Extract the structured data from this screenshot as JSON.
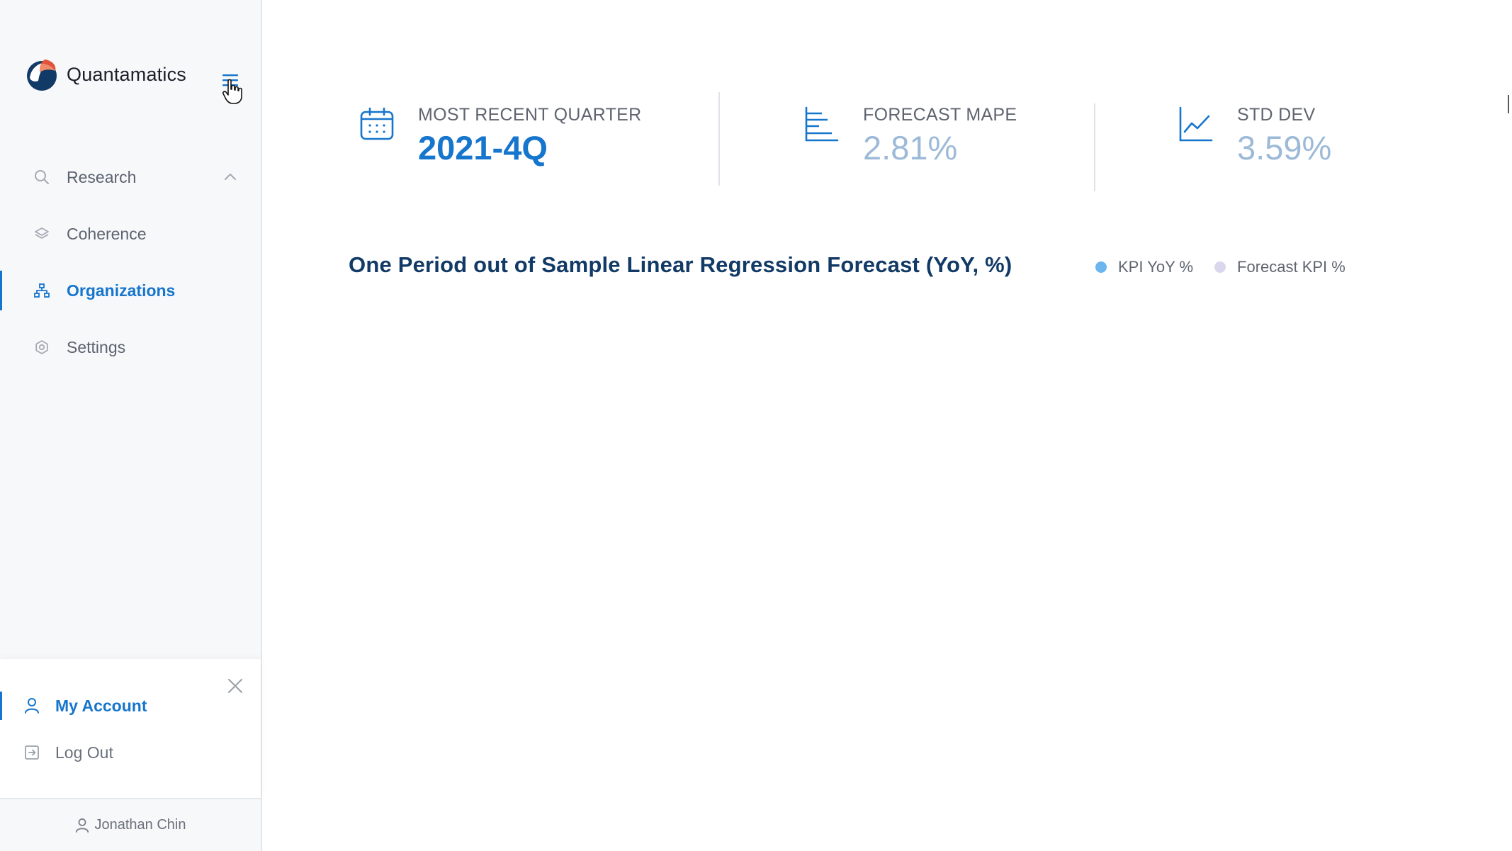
{
  "brand": {
    "name": "Quantamatics"
  },
  "sidebar": {
    "nav": [
      {
        "label": "Research",
        "icon": "search-icon",
        "active": false
      },
      {
        "label": "Coherence",
        "icon": "layers-icon",
        "active": false
      },
      {
        "label": "Organizations",
        "icon": "org-chart-icon",
        "active": true
      },
      {
        "label": "Settings",
        "icon": "gear-icon",
        "active": false
      }
    ],
    "account_menu": [
      {
        "label": "My Account",
        "icon": "user-icon",
        "active": true
      },
      {
        "label": "Log Out",
        "icon": "logout-icon",
        "active": false
      }
    ],
    "user_name": "Jonathan Chin"
  },
  "kpis": [
    {
      "label": "MOST RECENT QUARTER",
      "value": "2021-4Q",
      "icon": "calendar-icon"
    },
    {
      "label": "FORECAST MAPE",
      "value": "2.81%",
      "icon": "bar-list-icon"
    },
    {
      "label": "STD DEV",
      "value": "3.59%",
      "icon": "line-chart-icon"
    }
  ],
  "chart": {
    "title": "One Period out of Sample Linear Regression Forecast (YoY, %)",
    "legend": [
      {
        "label": "KPI YoY %",
        "color": "#6bb6ee"
      },
      {
        "label": "Forecast KPI %",
        "color": "#d9d6ee"
      }
    ]
  },
  "colors": {
    "accent": "#1675cc",
    "muted_value": "#9cbad8",
    "title": "#123a66"
  }
}
